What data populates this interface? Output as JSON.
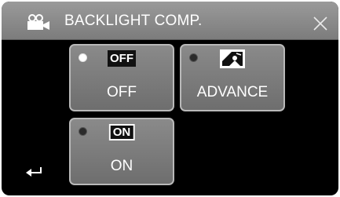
{
  "header": {
    "title": "BACKLIGHT COMP.",
    "mode_icon": "video-camera-icon",
    "close_icon": "close-icon"
  },
  "options": {
    "off": {
      "badge": "OFF",
      "label": "OFF",
      "selected": true
    },
    "advance": {
      "icon": "backlight-advance-icon",
      "label": "ADVANCE",
      "selected": false
    },
    "on": {
      "badge": "ON",
      "label": "ON",
      "selected": false
    }
  },
  "footer": {
    "back_icon": "back-arrow-icon"
  }
}
